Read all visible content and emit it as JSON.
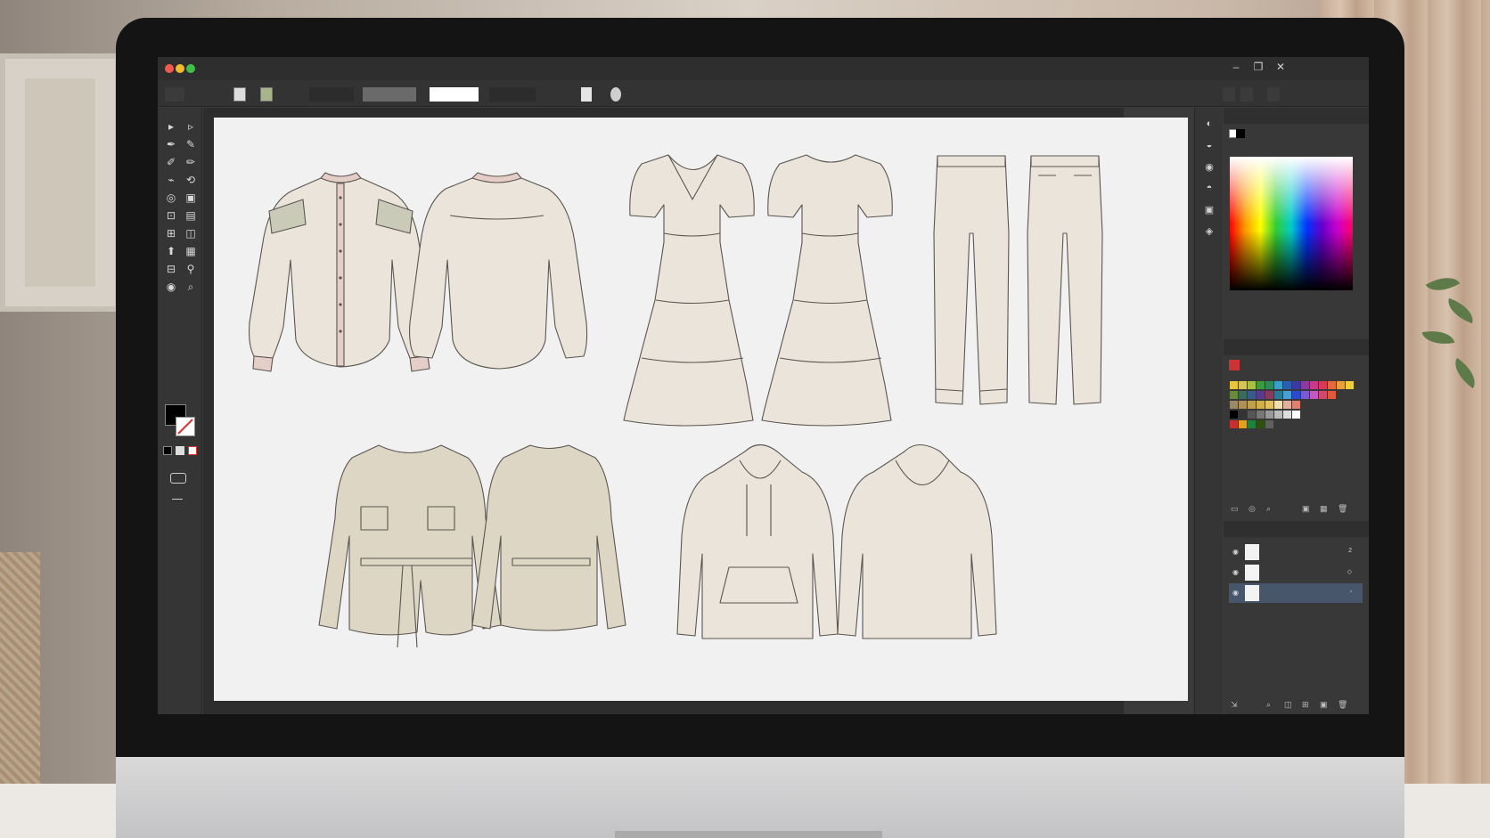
{
  "colors": {
    "accent_selection": "#48566b",
    "sketch_fill": "#ebe4da",
    "sketch_tint_jacket": "#ddd6c4",
    "blouse_trim": "#e6cec8",
    "blouse_yoke": "#c9cbb8",
    "sketch_stroke": "#5a5550"
  },
  "window_controls": {
    "minimize": "–",
    "maximize": "❐",
    "close": "✕"
  },
  "icons": {
    "selection_tool": "selection-tool-icon",
    "direct_selection_tool": "direct-selection-tool-icon",
    "pen_tool": "pen-tool-icon",
    "zoom_tool": "zoom-tool-icon",
    "eyedropper_tool": "eyedropper-tool-icon",
    "hand_tool": "hand-tool-icon"
  },
  "toolbar": {
    "glyphs": [
      "▸",
      "▹",
      "✒",
      "✎",
      "✐",
      "✏",
      "⌁",
      "⟲",
      "◎",
      "▣",
      "⊡",
      "▤",
      "⊞",
      "◫",
      "⬆",
      "▦",
      "⊟",
      "⚲",
      "◉",
      "⌕"
    ]
  },
  "swatches": {
    "row1": [
      "#e8c53a",
      "#d6c25a",
      "#a9c143",
      "#3e9a3e",
      "#2f8a5b",
      "#3aa0c8",
      "#2a5fb0",
      "#3a3aa0",
      "#8a3aa0",
      "#c83a8a",
      "#d83a5a",
      "#e26a3a",
      "#e8a03a",
      "#f0d03a"
    ],
    "row2": [
      "#6a8a3a",
      "#3a6a5a",
      "#3a5a8a",
      "#5a3a8a",
      "#8a3a5a",
      "#2a7a9a",
      "#4aa0d0",
      "#2a4ad0",
      "#7a5ad0",
      "#c05ac0",
      "#d04a6a",
      "#e05a3a"
    ],
    "row3": [
      "#9a8a6a",
      "#b0905a",
      "#c0a04a",
      "#d0b04a",
      "#e0c060",
      "#f0e0b0",
      "#e0b0a0",
      "#e08070"
    ],
    "row4": [
      "#000000",
      "#333333",
      "#555555",
      "#777777",
      "#999999",
      "#bbbbbb",
      "#dddddd",
      "#ffffff"
    ],
    "row5": [
      "#c83030",
      "#e0a020",
      "#208040",
      "#305010",
      "#606060"
    ]
  },
  "layers": {
    "rows": [
      {
        "num": "2",
        "num_icon": ""
      },
      {
        "num": "",
        "num_icon": "◇"
      },
      {
        "num": "",
        "num_icon": "◦"
      }
    ]
  }
}
